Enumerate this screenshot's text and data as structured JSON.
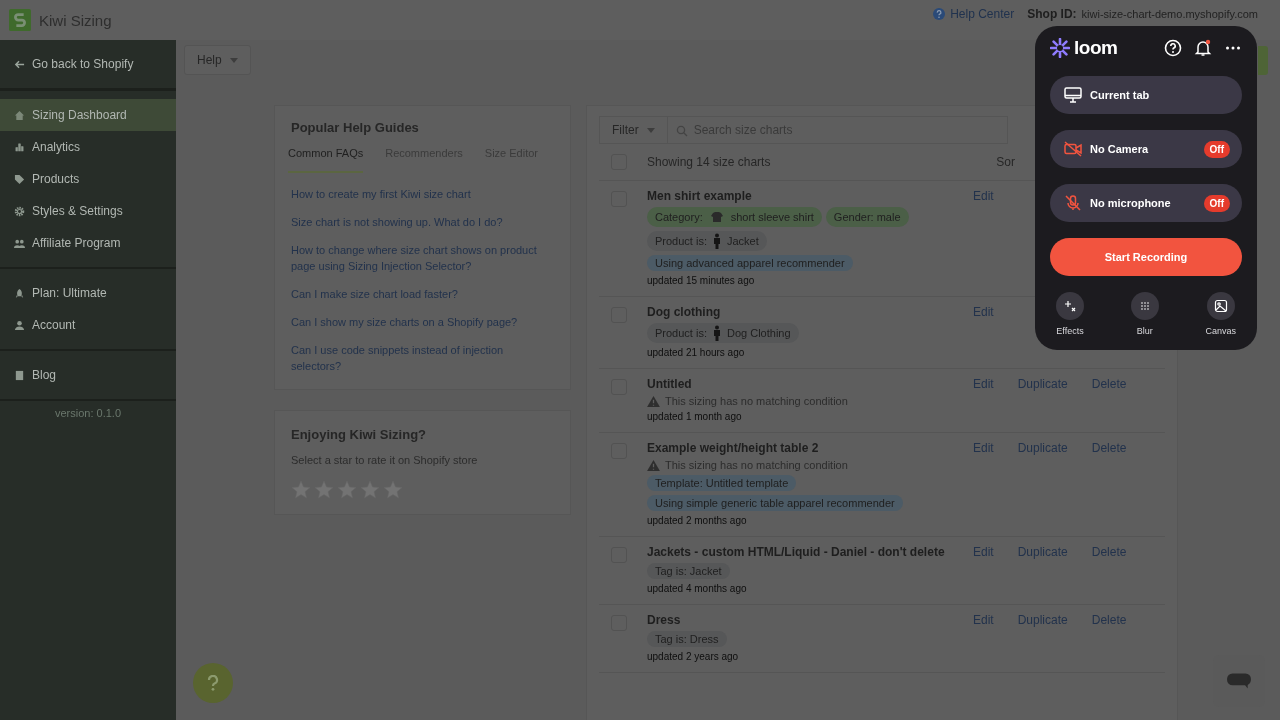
{
  "app": {
    "title": "Kiwi Sizing",
    "help_center": "Help Center",
    "shop_label": "Shop ID:",
    "shop_id": "kiwi-size-chart-demo.myshopify.com"
  },
  "sidebar": {
    "back": "Go back to Shopify",
    "groups": [
      [
        {
          "label": "Sizing Dashboard",
          "kind": "house",
          "selected": true
        },
        {
          "label": "Analytics",
          "kind": "chart",
          "selected": false
        },
        {
          "label": "Products",
          "kind": "tag",
          "selected": false
        },
        {
          "label": "Styles & Settings",
          "kind": "gear",
          "selected": false
        },
        {
          "label": "Affiliate Program",
          "kind": "people",
          "selected": false
        }
      ],
      [
        {
          "label": "Plan: Ultimate",
          "kind": "rocket",
          "selected": false
        },
        {
          "label": "Account",
          "kind": "person",
          "selected": false
        }
      ],
      [
        {
          "label": "Blog",
          "kind": "book",
          "selected": false
        }
      ]
    ],
    "version": "version: 0.1.0"
  },
  "help_button": "Help",
  "guides": {
    "title": "Popular Help Guides",
    "tabs": [
      {
        "label": "Common FAQs",
        "selected": true
      },
      {
        "label": "Recommenders",
        "selected": false
      },
      {
        "label": "Size Editor",
        "selected": false
      }
    ],
    "links": [
      "How to create my first Kiwi size chart",
      "Size chart is not showing up. What do I do?",
      "How to change where size chart shows on product page using Sizing Injection Selector?",
      "Can I make size chart load faster?",
      "Can I show my size charts on a Shopify page?",
      "Can I use code snippets instead of injection selectors?"
    ]
  },
  "rating": {
    "title": "Enjoying Kiwi Sizing?",
    "subtitle": "Select a star to rate it on Shopify store",
    "stars": 0
  },
  "charts": {
    "filter": "Filter",
    "search_placeholder": "Search size charts",
    "all_checked": false,
    "showing": "Showing 14 size charts",
    "sort": "Sor",
    "rows": [
      {
        "title": "Men shirt example",
        "checked": false,
        "warning": null,
        "tag_lines": [
          [
            {
              "kind": "thumb",
              "text": "Category:",
              "value": "short sleeve shirt",
              "color": "#4b5f47"
            },
            {
              "kind": "plain",
              "text": "Gender: male",
              "color": "#4b5f47"
            }
          ],
          [
            {
              "kind": "figure",
              "text": "Product is:",
              "value": "Jacket",
              "color": "#565758"
            }
          ],
          [
            {
              "kind": "plain",
              "text": "Using advanced apparel recommender",
              "color": "#4c5b66"
            }
          ]
        ],
        "updated": "updated 15 minutes ago",
        "actions": [
          "Edit"
        ]
      },
      {
        "title": "Dog clothing",
        "checked": false,
        "warning": null,
        "tag_lines": [
          [
            {
              "kind": "figure",
              "text": "Product is:",
              "value": "Dog Clothing",
              "color": "#565758"
            }
          ]
        ],
        "updated": "updated 21 hours ago",
        "actions": [
          "Edit"
        ]
      },
      {
        "title": "Untitled",
        "checked": false,
        "warning": "This sizing has no matching condition",
        "tag_lines": [],
        "updated": "updated 1 month ago",
        "actions": [
          "Edit",
          "Duplicate",
          "Delete"
        ]
      },
      {
        "title": "Example weight/height table 2",
        "checked": false,
        "warning": "This sizing has no matching condition",
        "tag_lines": [
          [
            {
              "kind": "plain",
              "text": "Template: Untitled template",
              "color": "#4c5b66"
            }
          ],
          [
            {
              "kind": "plain",
              "text": "Using simple generic table apparel recommender",
              "color": "#4c5b66"
            }
          ]
        ],
        "updated": "updated 2 months ago",
        "actions": [
          "Edit",
          "Duplicate",
          "Delete"
        ]
      },
      {
        "title": "Jackets - custom HTML/Liquid - Daniel - don't delete",
        "checked": false,
        "warning": null,
        "tag_lines": [
          [
            {
              "kind": "plain",
              "text": "Tag is: Jacket",
              "color": "#565758"
            }
          ]
        ],
        "updated": "updated 4 months ago",
        "actions": [
          "Edit",
          "Duplicate",
          "Delete"
        ]
      },
      {
        "title": "Dress",
        "checked": false,
        "warning": null,
        "tag_lines": [
          [
            {
              "kind": "plain",
              "text": "Tag is: Dress",
              "color": "#565758"
            }
          ]
        ],
        "updated": "updated 2 years ago",
        "actions": [
          "Edit",
          "Duplicate",
          "Delete"
        ]
      }
    ]
  },
  "loom": {
    "brand": "loom",
    "source": "Current tab",
    "devices": [
      {
        "kind": "camera",
        "label": "No Camera",
        "badge": "Off",
        "on": false
      },
      {
        "kind": "mic",
        "label": "No microphone",
        "badge": "Off",
        "on": false
      }
    ],
    "record": "Start Recording",
    "tools": [
      {
        "kind": "effects",
        "label": "Effects"
      },
      {
        "kind": "blur",
        "label": "Blur"
      },
      {
        "kind": "canvas",
        "label": "Canvas"
      }
    ]
  }
}
